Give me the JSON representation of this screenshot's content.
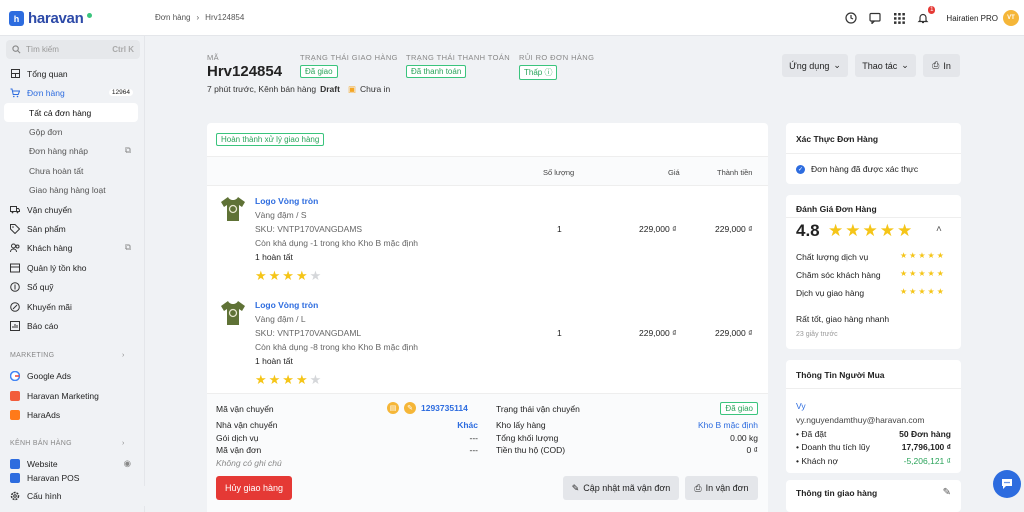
{
  "brand": "haravan",
  "breadcrumb": {
    "parent": "Đơn hàng",
    "current": "Hrv124854"
  },
  "user": {
    "name": "Hairatien PRO",
    "initials": "VT",
    "notif_count": "1"
  },
  "search": {
    "placeholder": "Tìm kiếm",
    "shortcut": "Ctrl K"
  },
  "sidebar": {
    "items": [
      {
        "label": "Tổng quan"
      },
      {
        "label": "Đơn hàng",
        "count": "12964"
      },
      {
        "label": "Tất cả đơn hàng"
      },
      {
        "label": "Gộp đơn"
      },
      {
        "label": "Đơn hàng nháp"
      },
      {
        "label": "Chưa hoàn tất"
      },
      {
        "label": "Giao hàng hàng loạt"
      },
      {
        "label": "Vận chuyển"
      },
      {
        "label": "Sản phẩm"
      },
      {
        "label": "Khách hàng"
      },
      {
        "label": "Quản lý tồn kho"
      },
      {
        "label": "Sổ quỹ"
      },
      {
        "label": "Khuyến mãi"
      },
      {
        "label": "Báo cáo"
      }
    ],
    "marketing_title": "MARKETING",
    "marketing": [
      {
        "label": "Google Ads"
      },
      {
        "label": "Haravan Marketing"
      },
      {
        "label": "HaraAds"
      }
    ],
    "channels_title": "KÊNH BÁN HÀNG",
    "channels": [
      {
        "label": "Website"
      },
      {
        "label": "Haravan POS"
      }
    ],
    "config": "Cấu hình"
  },
  "order": {
    "code_label": "MÃ",
    "code": "Hrv124854",
    "meta": "7 phút trước, Kênh bán hàng",
    "draft": "Draft",
    "unpaid": "Chưa in",
    "ship_status_label": "TRẠNG THÁI GIAO HÀNG",
    "ship_status": "Đã giao",
    "pay_status_label": "TRẠNG THÁI THANH TOÁN",
    "pay_status": "Đã thanh toán",
    "risk_label": "RỦI RO ĐƠN HÀNG",
    "risk": "Thấp"
  },
  "actions": {
    "apps": "Ứng dụng",
    "ops": "Thao tác",
    "print": "In"
  },
  "fulfill": {
    "badge": "Hoàn thành xử lý giao hàng",
    "col_qty": "Số lượng",
    "col_price": "Giá",
    "col_total": "Thành tiền"
  },
  "lines": [
    {
      "name": "Logo Vòng tròn",
      "variant": "Vàng đậm / S",
      "sku": "SKU: VNTP170VANGDAMS",
      "stock": "Còn khả dụng -1 trong kho Kho B mặc định",
      "done": "1 hoàn tất",
      "qty": "1",
      "price": "229,000 ₫",
      "total": "229,000 ₫",
      "rating": 4
    },
    {
      "name": "Logo Vòng tròn",
      "variant": "Vàng đậm / L",
      "sku": "SKU: VNTP170VANGDAML",
      "stock": "Còn khả dụng -8 trong kho Kho B mặc định",
      "done": "1 hoàn tất",
      "qty": "1",
      "price": "229,000 ₫",
      "total": "229,000 ₫",
      "rating": 4
    }
  ],
  "shipping": {
    "tracking_label": "Mã vận chuyển",
    "tracking": "1293735114",
    "carrier_label": "Nhà vận chuyển",
    "carrier": "Khác",
    "service_label": "Gói dịch vụ",
    "service": "---",
    "bill_label": "Mã vận đơn",
    "bill": "---",
    "note": "Không có ghi chú",
    "status_label": "Trạng thái vận chuyển",
    "status": "Đã giao",
    "warehouse_label": "Kho lấy hàng",
    "warehouse": "Kho B mặc định",
    "weight_label": "Tổng khối lượng",
    "weight": "0.00 kg",
    "cod_label": "Tiền thu hộ (COD)",
    "cod": "0 ₫",
    "cancel": "Hủy giao hàng",
    "update": "Cập nhật mã vận đơn",
    "print": "In vận đơn"
  },
  "verify": {
    "title": "Xác Thực Đơn Hàng",
    "text": "Đơn hàng đã được xác thực"
  },
  "review": {
    "title": "Đánh Giá Đơn Hàng",
    "score": "4.8",
    "items": [
      {
        "label": "Chất lượng dịch vụ"
      },
      {
        "label": "Chăm sóc khách hàng"
      },
      {
        "label": "Dịch vụ giao hàng"
      }
    ],
    "comment": "Rất tốt, giao hàng nhanh",
    "time": "23 giây trước"
  },
  "buyer": {
    "title": "Thông Tin Người Mua",
    "name": "Vy",
    "email": "vy.nguyendamthuy@haravan.com",
    "stats": [
      {
        "label": "• Đã đặt",
        "value": "50 Đơn hàng"
      },
      {
        "label": "• Doanh thu tích lũy",
        "value": "17,796,100 ₫"
      },
      {
        "label": "• Khách nợ",
        "value": "-5,206,121 ₫"
      }
    ]
  },
  "delivery_info": {
    "title": "Thông tin giao hàng"
  },
  "colors": {
    "accent": "#2d6cdf",
    "success": "#3ac47d",
    "danger": "#e53935",
    "star": "#f5c518"
  }
}
